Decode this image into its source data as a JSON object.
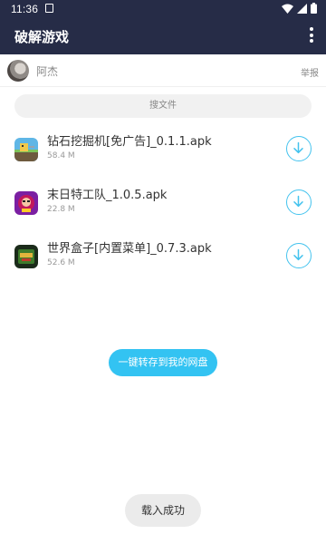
{
  "status_bar": {
    "time": "11:36",
    "icons": [
      "notification-icon",
      "wifi-icon",
      "signal-icon",
      "battery-icon"
    ]
  },
  "app_bar": {
    "title": "破解游戏",
    "menu_icon": "more-vert-icon"
  },
  "user": {
    "name": "阿杰",
    "report_label": "举报"
  },
  "search": {
    "placeholder": "搜文件"
  },
  "files": [
    {
      "name": "钻石挖掘机[免广告]_0.1.1.apk",
      "size": "58.4 M",
      "icon": "pixel-miner-game-icon"
    },
    {
      "name": "末日特工队_1.0.5.apk",
      "size": "22.8 M",
      "icon": "doomsday-agent-game-icon"
    },
    {
      "name": "世界盒子[内置菜单]_0.7.3.apk",
      "size": "52.6 M",
      "icon": "worldbox-game-icon"
    }
  ],
  "save_button": {
    "label": "一键转存到我的网盘"
  },
  "toast": {
    "text": "载入成功"
  },
  "colors": {
    "app_bar": "#262c47",
    "accent": "#33c3f2",
    "download_icon": "#44c3ee",
    "search_bg": "#f1f1f1"
  }
}
